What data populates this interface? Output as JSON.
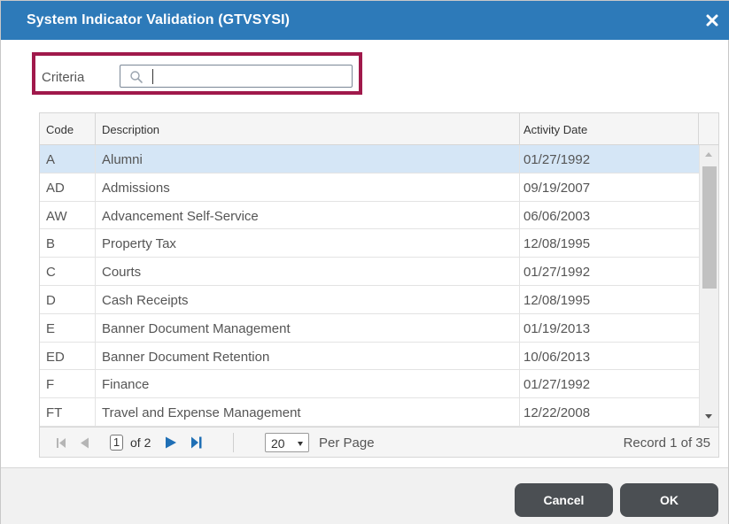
{
  "dialog": {
    "title": "System Indicator Validation (GTVSYSI)",
    "accent_color": "#2d7ab9",
    "highlight_color": "#a0194b"
  },
  "criteria": {
    "label": "Criteria",
    "value": "",
    "icon": "search-icon"
  },
  "grid": {
    "columns": [
      "Code",
      "Description",
      "Activity Date"
    ],
    "rows": [
      {
        "code": "A",
        "description": "Alumni",
        "date": "01/27/1992",
        "selected": true
      },
      {
        "code": "AD",
        "description": "Admissions",
        "date": "09/19/2007"
      },
      {
        "code": "AW",
        "description": "Advancement Self-Service",
        "date": "06/06/2003"
      },
      {
        "code": "B",
        "description": "Property Tax",
        "date": "12/08/1995"
      },
      {
        "code": "C",
        "description": "Courts",
        "date": "01/27/1992"
      },
      {
        "code": "D",
        "description": "Cash Receipts",
        "date": "12/08/1995"
      },
      {
        "code": "E",
        "description": "Banner Document Management",
        "date": "01/19/2013"
      },
      {
        "code": "ED",
        "description": "Banner Document Retention",
        "date": "10/06/2013"
      },
      {
        "code": "F",
        "description": "Finance",
        "date": "01/27/1992"
      },
      {
        "code": "FT",
        "description": "Travel and Expense Management",
        "date": "12/22/2008"
      }
    ]
  },
  "pager": {
    "page": "1",
    "of_text": "of 2",
    "page_size": "20",
    "per_page_label": "Per Page",
    "record_text": "Record 1 of 35"
  },
  "buttons": {
    "cancel": "Cancel",
    "ok": "OK"
  }
}
